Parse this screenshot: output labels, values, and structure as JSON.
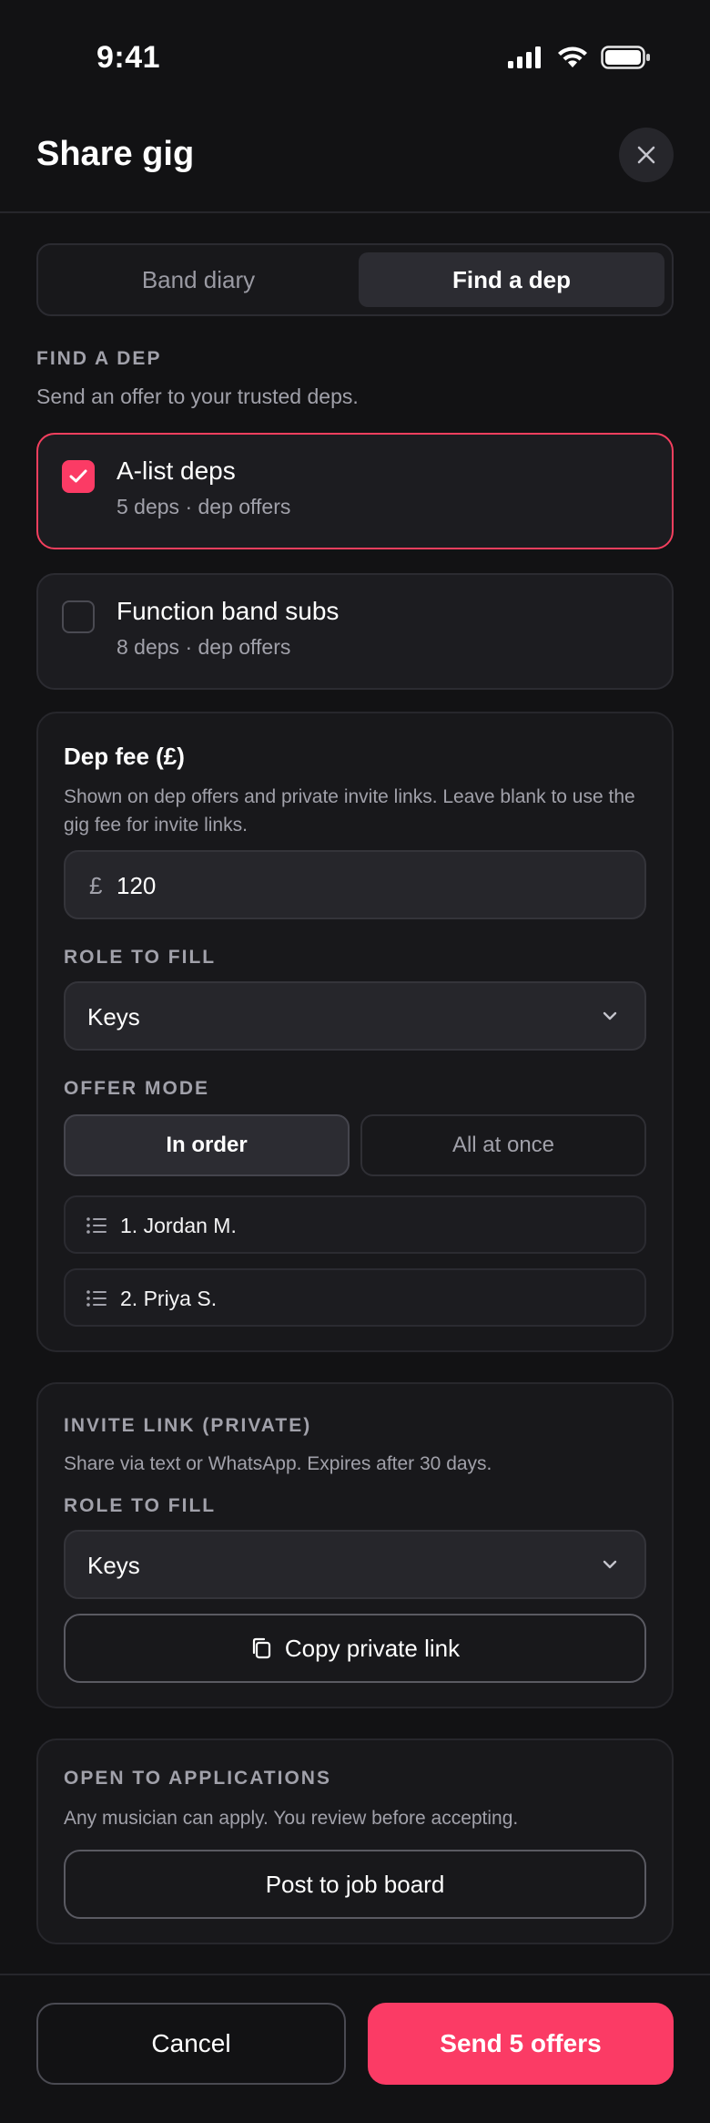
{
  "status_bar": {
    "time": "9:41"
  },
  "header": {
    "title": "Share gig"
  },
  "tabs": {
    "items": [
      {
        "label": "Band diary",
        "active": false
      },
      {
        "label": "Find a dep",
        "active": true
      }
    ]
  },
  "find_dep": {
    "heading": "FIND A DEP",
    "subtitle": "Send an offer to your trusted deps.",
    "groups": [
      {
        "name": "A-list deps",
        "meta": "5 deps · dep offers",
        "checked": true
      },
      {
        "name": "Function band subs",
        "meta": "8 deps · dep offers",
        "checked": false
      }
    ]
  },
  "dep_fee": {
    "title": "Dep fee (£)",
    "description": "Shown on dep offers and private invite links. Leave blank to use the gig fee for invite links.",
    "currency_symbol": "£",
    "value": "120",
    "role_label": "ROLE TO FILL",
    "role_value": "Keys",
    "offer_mode_label": "OFFER MODE",
    "offer_modes": [
      {
        "label": "In order",
        "active": true
      },
      {
        "label": "All at once",
        "active": false
      }
    ],
    "order_list": [
      "1. Jordan M.",
      "2. Priya S."
    ]
  },
  "invite_link": {
    "heading": "INVITE LINK (PRIVATE)",
    "description": "Share via text or WhatsApp. Expires after 30 days.",
    "role_label": "ROLE TO FILL",
    "role_value": "Keys",
    "copy_button": "Copy private link"
  },
  "applications": {
    "heading": "OPEN TO APPLICATIONS",
    "description": "Any musician can apply. You review before accepting.",
    "post_button": "Post to job board"
  },
  "footer": {
    "cancel": "Cancel",
    "send": "Send 5 offers"
  },
  "colors": {
    "accent": "#fb3b65",
    "background": "#121214",
    "surface": "#18181b"
  }
}
